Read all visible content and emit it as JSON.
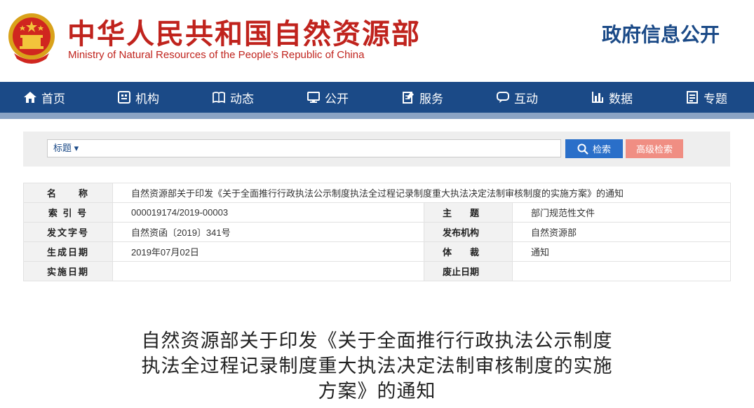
{
  "header": {
    "site_title_cn": "中华人民共和国自然资源部",
    "site_title_en": "Ministry of Natural Resources of the People’s Republic of China",
    "section_title": "政府信息公开"
  },
  "nav": {
    "items": [
      {
        "label": "首页",
        "icon": "home-icon"
      },
      {
        "label": "机构",
        "icon": "org-icon"
      },
      {
        "label": "动态",
        "icon": "book-icon"
      },
      {
        "label": "公开",
        "icon": "monitor-icon"
      },
      {
        "label": "服务",
        "icon": "edit-icon"
      },
      {
        "label": "互动",
        "icon": "chat-icon"
      },
      {
        "label": "数据",
        "icon": "bar-chart-icon"
      },
      {
        "label": "专题",
        "icon": "list-icon"
      }
    ]
  },
  "search": {
    "type_label": "标题 ▾",
    "value": "",
    "placeholder": "",
    "search_label": "检索",
    "advanced_label": "高级检索"
  },
  "meta": {
    "name_label": "名　　称",
    "name_value": "自然资源部关于印发《关于全面推行行政执法公示制度执法全过程记录制度重大执法决定法制审核制度的实施方案》的通知",
    "index_label": "索 引 号",
    "index_value": "000019174/2019-00003",
    "topic_label": "主　　题",
    "topic_value": "部门规范性文件",
    "docno_label": "发文字号",
    "docno_value": "自然资函〔2019〕341号",
    "publisher_label": "发布机构",
    "publisher_value": "自然资源部",
    "created_label": "生成日期",
    "created_value": "2019年07月02日",
    "genre_label": "体　　裁",
    "genre_value": "通知",
    "effective_label": "实施日期",
    "effective_value": "",
    "expire_label": "废止日期",
    "expire_value": ""
  },
  "document": {
    "title": "自然资源部关于印发《关于全面推行行政执法公示制度执法全过程记录制度重大执法决定法制审核制度的实施方案》的通知"
  },
  "colors": {
    "brand_red": "#c0231d",
    "nav_blue": "#1b4a87",
    "search_blue": "#2a6fc9",
    "advanced_salmon": "#f08e83"
  }
}
